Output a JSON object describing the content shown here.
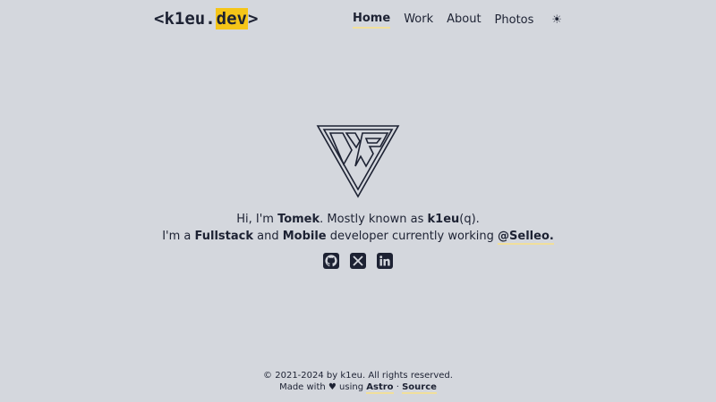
{
  "header": {
    "logo": {
      "open": "<",
      "name": "k1eu.",
      "tld": "dev",
      "close": ">"
    },
    "nav": [
      {
        "label": "Home",
        "active": true
      },
      {
        "label": "Work",
        "active": false
      },
      {
        "label": "About",
        "active": false
      },
      {
        "label": "Photos",
        "active": false,
        "external_glyph": ""
      }
    ],
    "theme_toggle": "☀"
  },
  "hero": {
    "logo_icon": "k1eu-triangle-logo",
    "line1": {
      "pre": "Hi, I'm ",
      "name": "Tomek",
      "mid": ". Mostly known as ",
      "handle": "k1eu",
      "post": "(q)."
    },
    "line2": {
      "pre": "I'm a ",
      "role1": "Fullstack",
      "and": " and ",
      "role2": "Mobile",
      "mid": " developer currently working ",
      "company": "@Selleo."
    }
  },
  "socials": [
    {
      "icon": "github-icon"
    },
    {
      "icon": "x-twitter-icon"
    },
    {
      "icon": "linkedin-icon"
    }
  ],
  "footer": {
    "copyright": "© 2021-2024 by k1eu. All rights reserved.",
    "made_with": "Made with ",
    "heart": "♥",
    "using": " using ",
    "astro": "Astro",
    "sep": " · ",
    "source": "Source"
  },
  "colors": {
    "background": "#d4d7dd",
    "text": "#1d2233",
    "accent": "#f5c518",
    "underline": "#f1df9b"
  }
}
